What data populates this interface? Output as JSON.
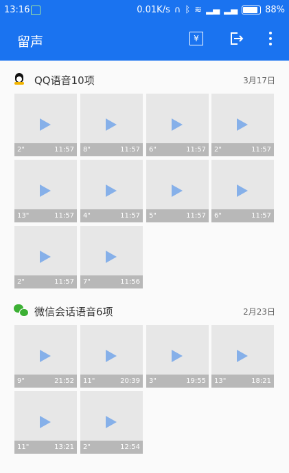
{
  "status_bar": {
    "time": "13:16",
    "network_speed": "0.01K/s",
    "battery": "88%"
  },
  "app_bar": {
    "title": "留声"
  },
  "groups": [
    {
      "title": "QQ语音10项",
      "date": "3月17日",
      "items": [
        {
          "duration": "2\"",
          "time": "11:57"
        },
        {
          "duration": "8\"",
          "time": "11:57"
        },
        {
          "duration": "6\"",
          "time": "11:57"
        },
        {
          "duration": "2\"",
          "time": "11:57"
        },
        {
          "duration": "13\"",
          "time": "11:57"
        },
        {
          "duration": "4\"",
          "time": "11:57"
        },
        {
          "duration": "5\"",
          "time": "11:57"
        },
        {
          "duration": "6\"",
          "time": "11:57"
        },
        {
          "duration": "2\"",
          "time": "11:57"
        },
        {
          "duration": "7\"",
          "time": "11:56"
        }
      ]
    },
    {
      "title": "微信会话语音6项",
      "date": "2月23日",
      "items": [
        {
          "duration": "9\"",
          "time": "21:52"
        },
        {
          "duration": "11\"",
          "time": "20:39"
        },
        {
          "duration": "3\"",
          "time": "19:55"
        },
        {
          "duration": "13\"",
          "time": "18:21"
        },
        {
          "duration": "11\"",
          "time": "13:21"
        },
        {
          "duration": "2\"",
          "time": "12:54"
        }
      ]
    }
  ]
}
